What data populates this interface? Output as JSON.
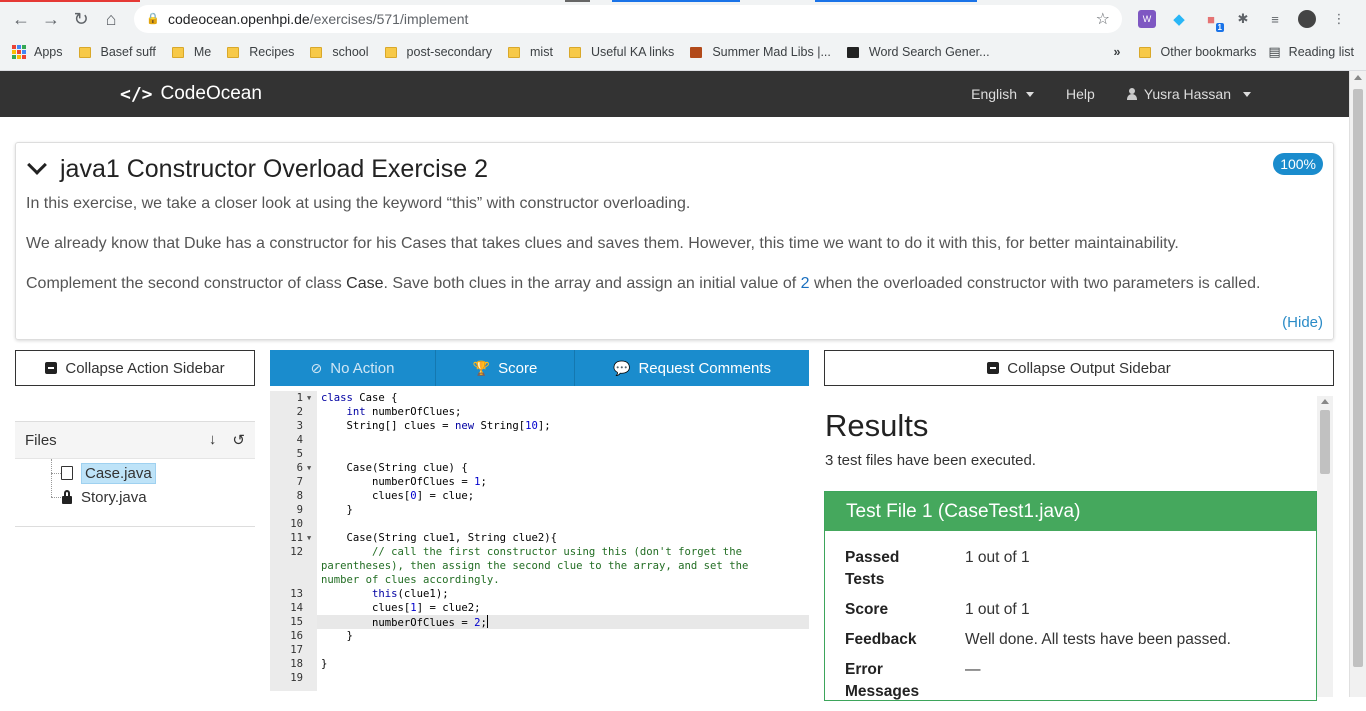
{
  "browser": {
    "url_host": "codeocean.openhpi.de",
    "url_path": "/exercises/571/implement",
    "bookmarks": [
      {
        "label": "Apps",
        "type": "apps"
      },
      {
        "label": "Basef suff",
        "type": "folder"
      },
      {
        "label": "Me",
        "type": "folder"
      },
      {
        "label": "Recipes",
        "type": "folder"
      },
      {
        "label": "school",
        "type": "folder"
      },
      {
        "label": "post-secondary",
        "type": "folder"
      },
      {
        "label": "mist",
        "type": "folder"
      },
      {
        "label": "Useful KA links",
        "type": "folder"
      },
      {
        "label": "Summer Mad Libs |...",
        "type": "page"
      },
      {
        "label": "Word Search Gener...",
        "type": "page"
      }
    ],
    "more_bookmarks": "»",
    "other_bookmarks": "Other bookmarks",
    "reading_list": "Reading list",
    "extension_badge": "1"
  },
  "app": {
    "brand": "CodeOcean",
    "brand_logo": "</>",
    "language": "English",
    "help": "Help",
    "user": "Yusra Hassan"
  },
  "exercise": {
    "title": "java1 Constructor Overload Exercise 2",
    "score_badge": "100%",
    "paragraph1": "In this exercise, we take a closer look at using the keyword “this” with constructor overloading.",
    "paragraph2": "We already know that Duke has a constructor for his Cases that takes clues and saves them. However, this time we want to do it with this, for better maintainability.",
    "paragraph3_a": "Complement the second constructor of class ",
    "paragraph3_code": "Case",
    "paragraph3_b": ". Save both clues in the array and assign an initial value of ",
    "paragraph3_num": "2",
    "paragraph3_c": " when the overloaded constructor with two parameters is called.",
    "hide_link": "(Hide)"
  },
  "sidebar": {
    "collapse_action": "Collapse Action Sidebar",
    "collapse_output": "Collapse Output Sidebar",
    "files_title": "Files",
    "files": [
      {
        "name": "Case.java",
        "icon": "document-icon",
        "active": true
      },
      {
        "name": "Story.java",
        "icon": "lock-icon",
        "active": false
      }
    ]
  },
  "toolbar": {
    "no_action": "No Action",
    "score": "Score",
    "request_comments": "Request Comments"
  },
  "editor": {
    "line_numbers": [
      "1",
      "2",
      "3",
      "4",
      "5",
      "6",
      "7",
      "8",
      "9",
      "10",
      "11",
      "12",
      "",
      "",
      "13",
      "14",
      "15",
      "16",
      "17",
      "18",
      "19"
    ],
    "fold_lines": [
      "1",
      "6",
      "11"
    ],
    "active_line": "15"
  },
  "results": {
    "title": "Results",
    "summary": "3 test files have been executed.",
    "test_file_title": "Test File 1 (CaseTest1.java)",
    "rows": [
      {
        "key": "Passed Tests",
        "value": "1 out of 1"
      },
      {
        "key": "Score",
        "value": "1 out of 1"
      },
      {
        "key": "Feedback",
        "value": "Well done. All tests have been passed."
      },
      {
        "key": "Error Messages",
        "value": "—"
      }
    ]
  },
  "colors": {
    "navbar": "#333333",
    "accent": "#1a8ccd",
    "success": "#45a85d",
    "code_keyword": "#0000a2",
    "code_comment": "#236e24"
  }
}
